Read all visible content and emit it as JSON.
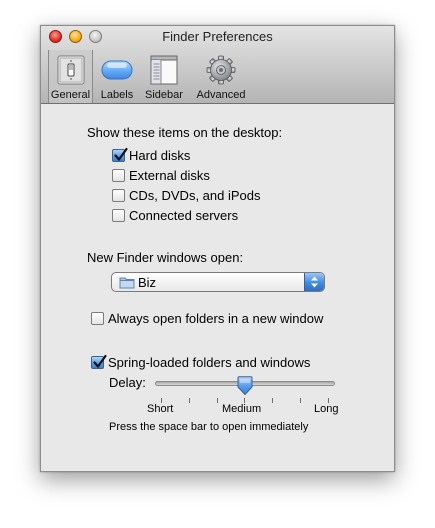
{
  "window": {
    "title": "Finder Preferences"
  },
  "toolbar": {
    "tabs": [
      {
        "label": "General",
        "icon": "light-switch-icon",
        "selected": true
      },
      {
        "label": "Labels",
        "icon": "label-pill-icon",
        "selected": false
      },
      {
        "label": "Sidebar",
        "icon": "sidebar-icon",
        "selected": false
      },
      {
        "label": "Advanced",
        "icon": "gear-icon",
        "selected": false
      }
    ]
  },
  "desktop": {
    "heading": "Show these items on the desktop:",
    "items": [
      {
        "label": "Hard disks",
        "checked": true
      },
      {
        "label": "External disks",
        "checked": false
      },
      {
        "label": "CDs, DVDs, and iPods",
        "checked": false
      },
      {
        "label": "Connected servers",
        "checked": false
      }
    ]
  },
  "new_window": {
    "label": "New Finder windows open:",
    "selected": "Biz"
  },
  "always_open": {
    "label": "Always open folders in a new window",
    "checked": false
  },
  "spring_loaded": {
    "label": "Spring-loaded folders and windows",
    "checked": true,
    "delay_label": "Delay:",
    "delay_value": 0.5,
    "labels": {
      "short": "Short",
      "medium": "Medium",
      "long": "Long"
    },
    "hint": "Press the space bar to open immediately"
  },
  "colors": {
    "accent": "#3f8ae4",
    "close": "#e0322b",
    "minimize": "#f5ad1f",
    "zoom": "#c9c9c9"
  }
}
